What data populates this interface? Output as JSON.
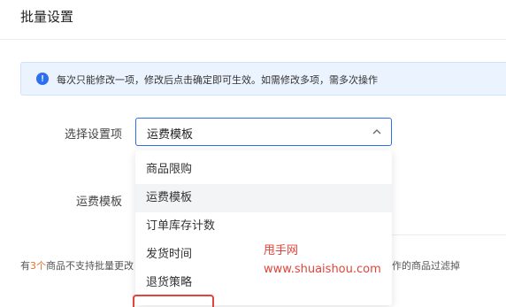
{
  "header": {
    "title": "批量设置"
  },
  "notice": {
    "icon": "info-icon",
    "text": "每次只能修改一项，修改后点击确定即可生效。如需修改多项，需多次操作"
  },
  "form": {
    "setting_label": "选择设置项",
    "setting_value": "运费模板",
    "template_label": "运费模板"
  },
  "dropdown": {
    "options": [
      {
        "label": "商品限购",
        "selected": false
      },
      {
        "label": "运费模板",
        "selected": true
      },
      {
        "label": "订单库存计数",
        "selected": false
      },
      {
        "label": "发货时间",
        "selected": false
      },
      {
        "label": "退货策略",
        "selected": false
      }
    ]
  },
  "footer": {
    "left_prefix": "有",
    "left_count": "3个",
    "left_suffix": "商品不支持批量更改",
    "right_text": "作的商品过滤掉"
  },
  "watermark": {
    "line1": "甩手网",
    "line2": "www.shuaishou.com"
  },
  "colors": {
    "accent": "#2c6ff0",
    "notice_bg": "#ebf3fe",
    "watermark": "#e0443b",
    "highlight": "#e8702a"
  }
}
